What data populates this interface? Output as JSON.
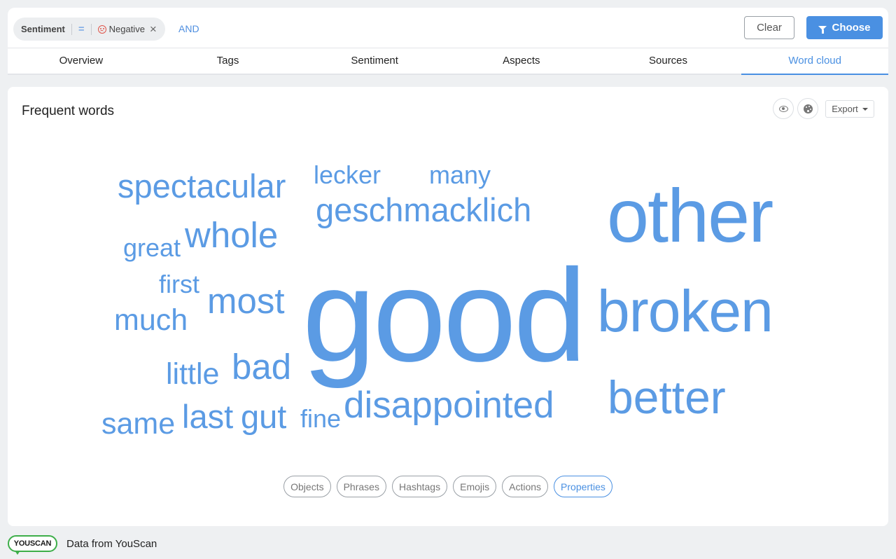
{
  "filter": {
    "field": "Sentiment",
    "operator": "=",
    "value": "Negative",
    "and_label": "AND"
  },
  "actions": {
    "clear": "Clear",
    "choose": "Choose"
  },
  "tabs": [
    {
      "label": "Overview",
      "active": false
    },
    {
      "label": "Tags",
      "active": false
    },
    {
      "label": "Sentiment",
      "active": false
    },
    {
      "label": "Aspects",
      "active": false
    },
    {
      "label": "Sources",
      "active": false
    },
    {
      "label": "Word cloud",
      "active": true
    }
  ],
  "card": {
    "title": "Frequent words",
    "export_label": "Export",
    "icons": [
      "eye-icon",
      "palette-icon"
    ]
  },
  "word_cloud": {
    "color": "#5b9be4",
    "words": [
      {
        "text": "good",
        "weight": 100
      },
      {
        "text": "other",
        "weight": 60
      },
      {
        "text": "broken",
        "weight": 46
      },
      {
        "text": "better",
        "weight": 37
      },
      {
        "text": "disappointed",
        "weight": 34
      },
      {
        "text": "geschmacklich",
        "weight": 31
      },
      {
        "text": "spectacular",
        "weight": 31
      },
      {
        "text": "whole",
        "weight": 33
      },
      {
        "text": "most",
        "weight": 33
      },
      {
        "text": "bad",
        "weight": 33
      },
      {
        "text": "gut",
        "weight": 30
      },
      {
        "text": "last",
        "weight": 30
      },
      {
        "text": "much",
        "weight": 28
      },
      {
        "text": "little",
        "weight": 28
      },
      {
        "text": "same",
        "weight": 28
      },
      {
        "text": "lecker",
        "weight": 24
      },
      {
        "text": "many",
        "weight": 24
      },
      {
        "text": "great",
        "weight": 24
      },
      {
        "text": "first",
        "weight": 24
      },
      {
        "text": "fine",
        "weight": 24
      }
    ]
  },
  "word_types": [
    {
      "label": "Objects",
      "active": false
    },
    {
      "label": "Phrases",
      "active": false
    },
    {
      "label": "Hashtags",
      "active": false
    },
    {
      "label": "Emojis",
      "active": false
    },
    {
      "label": "Actions",
      "active": false
    },
    {
      "label": "Properties",
      "active": true
    }
  ],
  "footer": {
    "logo": "YOUSCAN",
    "text": "Data from YouScan"
  }
}
